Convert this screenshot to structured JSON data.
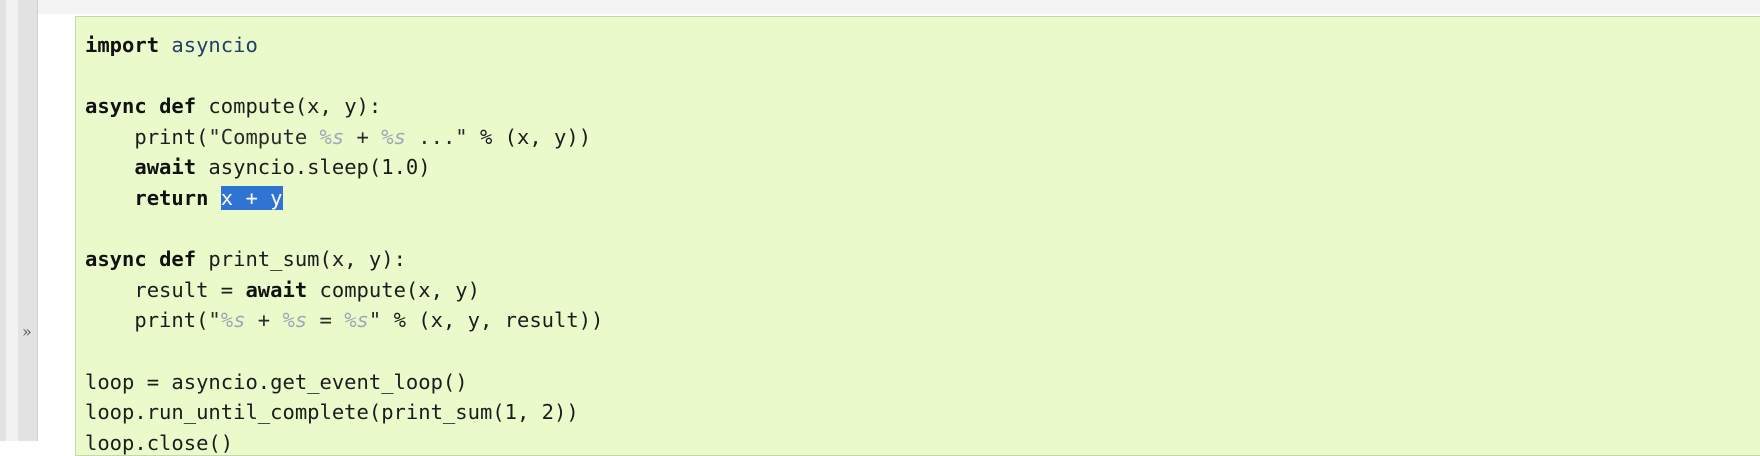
{
  "gutter": {
    "expand_marker": "»"
  },
  "code": {
    "lines": [
      [
        {
          "k": "kw",
          "t": "import"
        },
        {
          "k": "",
          "t": " "
        },
        {
          "k": "mod",
          "t": "asyncio"
        }
      ],
      [],
      [
        {
          "k": "kw",
          "t": "async"
        },
        {
          "k": "",
          "t": " "
        },
        {
          "k": "kw",
          "t": "def"
        },
        {
          "k": "",
          "t": " compute(x, y):"
        }
      ],
      [
        {
          "k": "",
          "t": "    print("
        },
        {
          "k": "str",
          "t": "\"Compute "
        },
        {
          "k": "fmt",
          "t": "%s"
        },
        {
          "k": "str",
          "t": " + "
        },
        {
          "k": "fmt",
          "t": "%s"
        },
        {
          "k": "str",
          "t": " ...\""
        },
        {
          "k": "",
          "t": " % (x, y))"
        }
      ],
      [
        {
          "k": "",
          "t": "    "
        },
        {
          "k": "kw",
          "t": "await"
        },
        {
          "k": "",
          "t": " asyncio.sleep(1.0)"
        }
      ],
      [
        {
          "k": "",
          "t": "    "
        },
        {
          "k": "kw",
          "t": "return"
        },
        {
          "k": "",
          "t": " "
        },
        {
          "k": "sel",
          "t": "x + y"
        }
      ],
      [],
      [
        {
          "k": "kw",
          "t": "async"
        },
        {
          "k": "",
          "t": " "
        },
        {
          "k": "kw",
          "t": "def"
        },
        {
          "k": "",
          "t": " print_sum(x, y):"
        }
      ],
      [
        {
          "k": "",
          "t": "    result = "
        },
        {
          "k": "kw",
          "t": "await"
        },
        {
          "k": "",
          "t": " compute(x, y)"
        }
      ],
      [
        {
          "k": "",
          "t": "    print("
        },
        {
          "k": "str",
          "t": "\""
        },
        {
          "k": "fmt",
          "t": "%s"
        },
        {
          "k": "str",
          "t": " + "
        },
        {
          "k": "fmt",
          "t": "%s"
        },
        {
          "k": "str",
          "t": " = "
        },
        {
          "k": "fmt",
          "t": "%s"
        },
        {
          "k": "str",
          "t": "\""
        },
        {
          "k": "",
          "t": " % (x, y, result))"
        }
      ],
      [],
      [
        {
          "k": "",
          "t": "loop = asyncio.get_event_loop()"
        }
      ],
      [
        {
          "k": "",
          "t": "loop.run_until_complete(print_sum(1, 2))"
        }
      ],
      [
        {
          "k": "",
          "t": "loop.close()"
        }
      ]
    ]
  }
}
